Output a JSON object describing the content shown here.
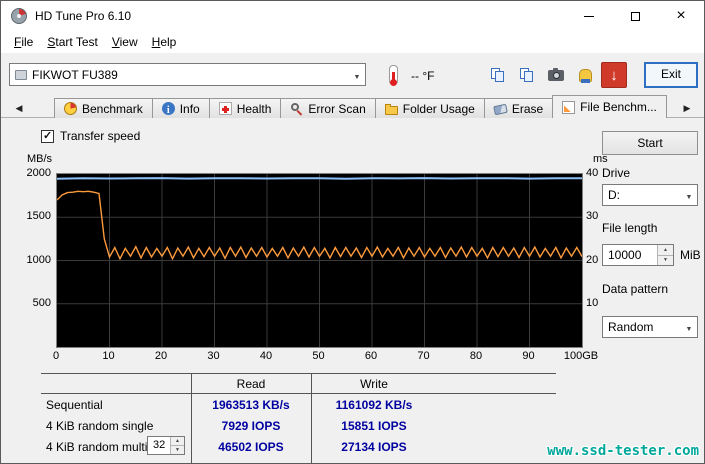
{
  "window": {
    "title": "HD Tune Pro 6.10"
  },
  "menu": {
    "items": [
      "File",
      "Start Test",
      "View",
      "Help"
    ]
  },
  "toolbar": {
    "device": "FIKWOT FU389",
    "temperature": "-- °F",
    "exit_label": "Exit"
  },
  "tabs": [
    {
      "label": "Benchmark",
      "icon": "speedometer-icon"
    },
    {
      "label": "Info",
      "icon": "info-icon"
    },
    {
      "label": "Health",
      "icon": "health-cross-icon"
    },
    {
      "label": "Error Scan",
      "icon": "magnifier-icon"
    },
    {
      "label": "Folder Usage",
      "icon": "folder-icon"
    },
    {
      "label": "Erase",
      "icon": "eraser-icon"
    },
    {
      "label": "File Benchm...",
      "icon": "file-benchmark-icon",
      "active": true
    }
  ],
  "panel": {
    "transfer_speed_label": "Transfer speed",
    "start_label": "Start",
    "drive_label": "Drive",
    "drive_value": "D:",
    "file_length_label": "File length",
    "file_length_value": "10000",
    "file_length_unit": "MiB",
    "data_pattern_label": "Data pattern",
    "data_pattern_value": "Random"
  },
  "chart_data": {
    "type": "line",
    "x_range_gb": [
      0,
      100
    ],
    "y_left": {
      "label": "MB/s",
      "range": [
        0,
        2000
      ],
      "ticks": [
        "2000",
        "1500",
        "1000",
        "500"
      ]
    },
    "y_right": {
      "label": "ms",
      "range": [
        0,
        40
      ],
      "ticks": [
        "40",
        "30",
        "20",
        "10"
      ]
    },
    "x_tick_labels": [
      "0",
      "10",
      "20",
      "30",
      "40",
      "50",
      "60",
      "70",
      "80",
      "90",
      "100GB"
    ],
    "grid": {
      "vertical_every_gb": 10,
      "horizontal_every_mbs": 500,
      "color": "#3a3a3a"
    },
    "series": [
      {
        "name": "sequential-read-speed",
        "color": "#8cbef8",
        "unit": "MB/s",
        "x_step_gb": 5,
        "values": [
          1945,
          1952,
          1948,
          1950,
          1953,
          1947,
          1951,
          1950,
          1948,
          1952,
          1950,
          1946,
          1951,
          1949,
          1953,
          1948,
          1950,
          1952,
          1947,
          1951,
          1950
        ]
      },
      {
        "name": "sequential-write-speed",
        "color": "#ff9b3d",
        "unit": "MB/s",
        "x_step_gb": 1,
        "values": [
          1700,
          1760,
          1785,
          1790,
          1800,
          1795,
          1800,
          1790,
          1775,
          1250,
          1040,
          1150,
          1020,
          1140,
          1050,
          1160,
          1030,
          1150,
          1040,
          1140,
          1050,
          1150,
          1020,
          1145,
          1050,
          1155,
          1030,
          1140,
          1045,
          1150,
          1050,
          1145,
          1025,
          1150,
          1050,
          1155,
          1035,
          1145,
          1050,
          1150,
          1040,
          1140,
          1050,
          1150,
          1030,
          1145,
          1050,
          1155,
          1040,
          1150,
          1050,
          1140,
          1030,
          1150,
          1045,
          1150,
          1050,
          1145,
          1035,
          1150,
          1050,
          1155,
          1040,
          1140,
          1050,
          1150,
          1030,
          1145,
          1050,
          1150,
          1040,
          1140,
          1050,
          1150,
          1035,
          1145,
          1050,
          1155,
          1040,
          1150,
          1050,
          1140,
          1030,
          1150,
          1045,
          1150,
          1050,
          1145,
          1035,
          1150,
          1050,
          1155,
          1040,
          1140,
          1050,
          1150,
          1030,
          1145,
          1050,
          1150,
          1045
        ]
      }
    ]
  },
  "results": {
    "col_headers": [
      "Read",
      "Write"
    ],
    "rows": [
      {
        "label": "Sequential",
        "read": "1963513 KB/s",
        "write": "1161092 KB/s"
      },
      {
        "label": "4 KiB random single",
        "read": "7929 IOPS",
        "write": "15851 IOPS"
      },
      {
        "label": "4 KiB random multi",
        "queue_depth": "32",
        "read": "46502 IOPS",
        "write": "27134 IOPS"
      }
    ]
  },
  "watermark": {
    "text": "www.ssd-tester.com"
  },
  "colors": {
    "read_line": "#8cbef8",
    "write_line": "#ff9b3d",
    "value_text": "#0000a0",
    "watermark": "#00a79b",
    "chart_background": "#000000",
    "exit_focus_border": "#2f6fc1"
  }
}
